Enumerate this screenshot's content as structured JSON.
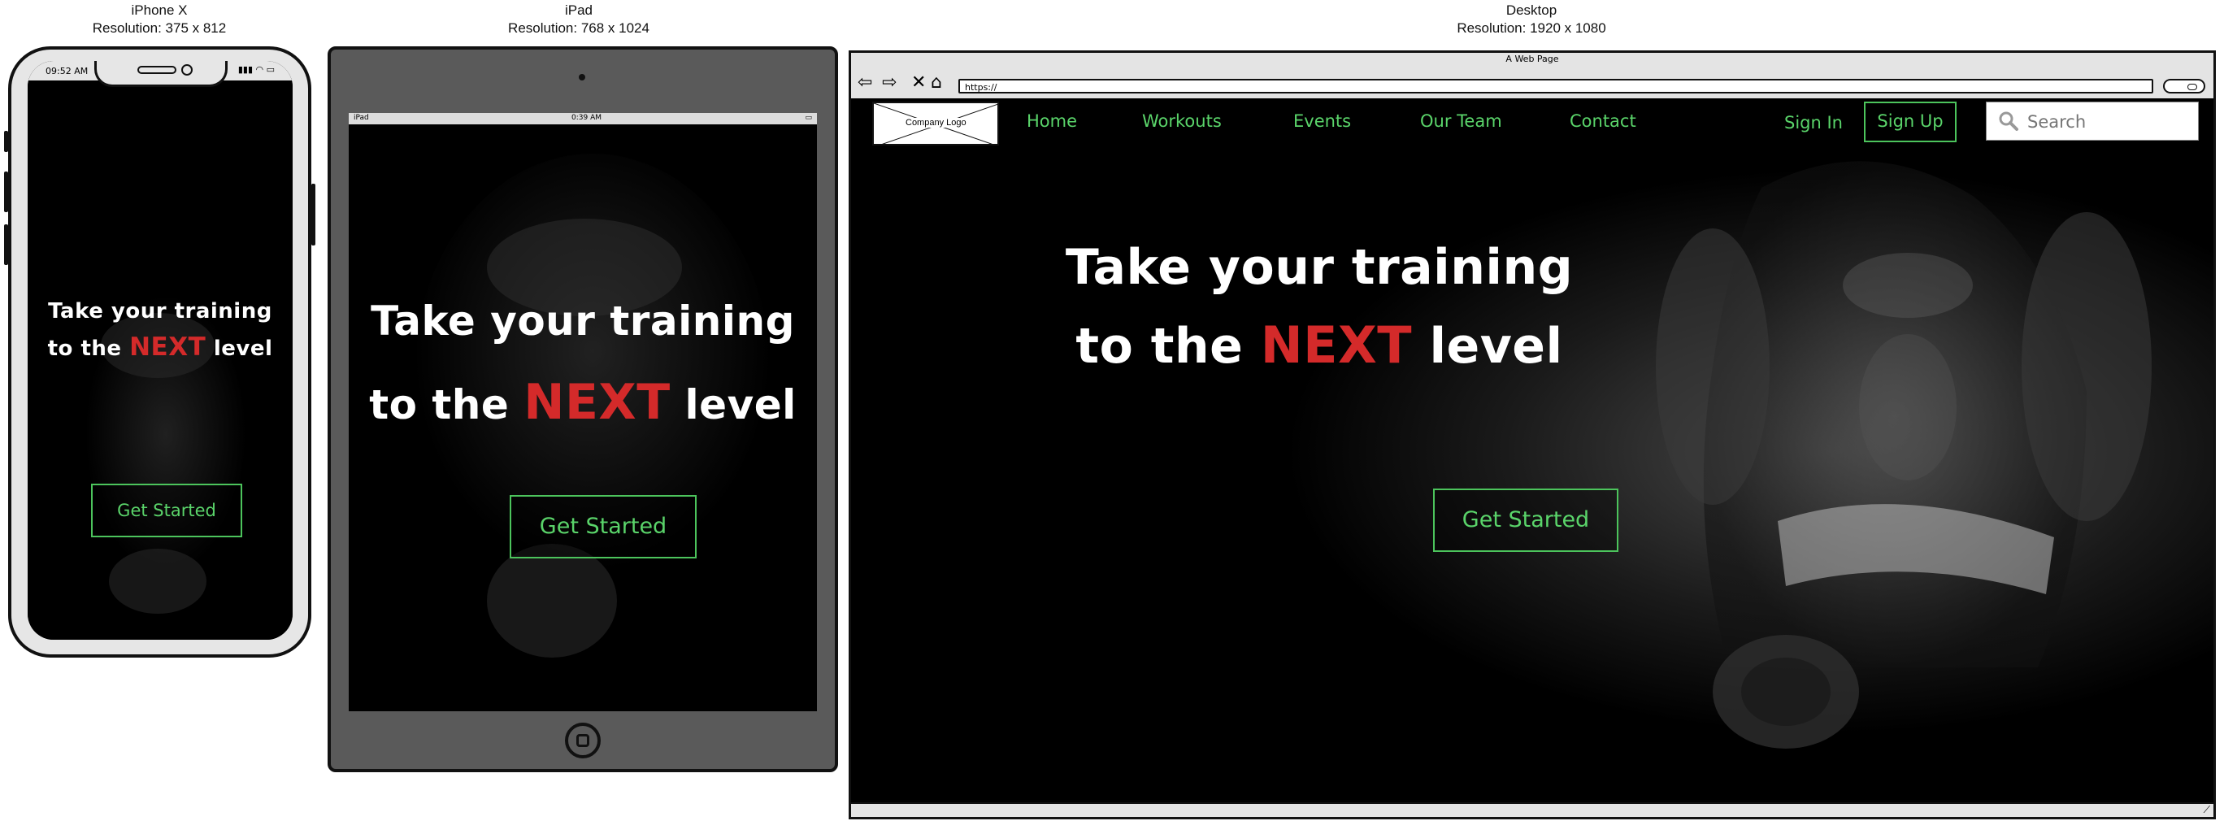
{
  "devices": {
    "iphone": {
      "name": "iPhone X",
      "resolution": "Resolution: 375 x 812",
      "time": "09:52 AM"
    },
    "ipad": {
      "name": "iPad",
      "resolution": "Resolution: 768 x 1024",
      "carrier": "iPad",
      "time": "0:39 AM"
    },
    "desktop": {
      "name": "Desktop",
      "resolution": "Resolution: 1920 x 1080"
    }
  },
  "browser": {
    "title": "A Web Page",
    "url": "https://"
  },
  "nav": {
    "logo": "Company Logo",
    "links": [
      "Home",
      "Workouts",
      "Events",
      "Our Team",
      "Contact"
    ],
    "sign_in": "Sign In",
    "sign_up": "Sign Up",
    "search_placeholder": "Search"
  },
  "hero": {
    "line1": "Take your training",
    "line2_prefix": "to the",
    "line2_highlight": "NEXT",
    "line2_suffix": "level",
    "cta": "Get Started"
  },
  "colors": {
    "accent_green": "#5ad46a",
    "highlight_red": "#d42a2a",
    "background": "#000000"
  }
}
